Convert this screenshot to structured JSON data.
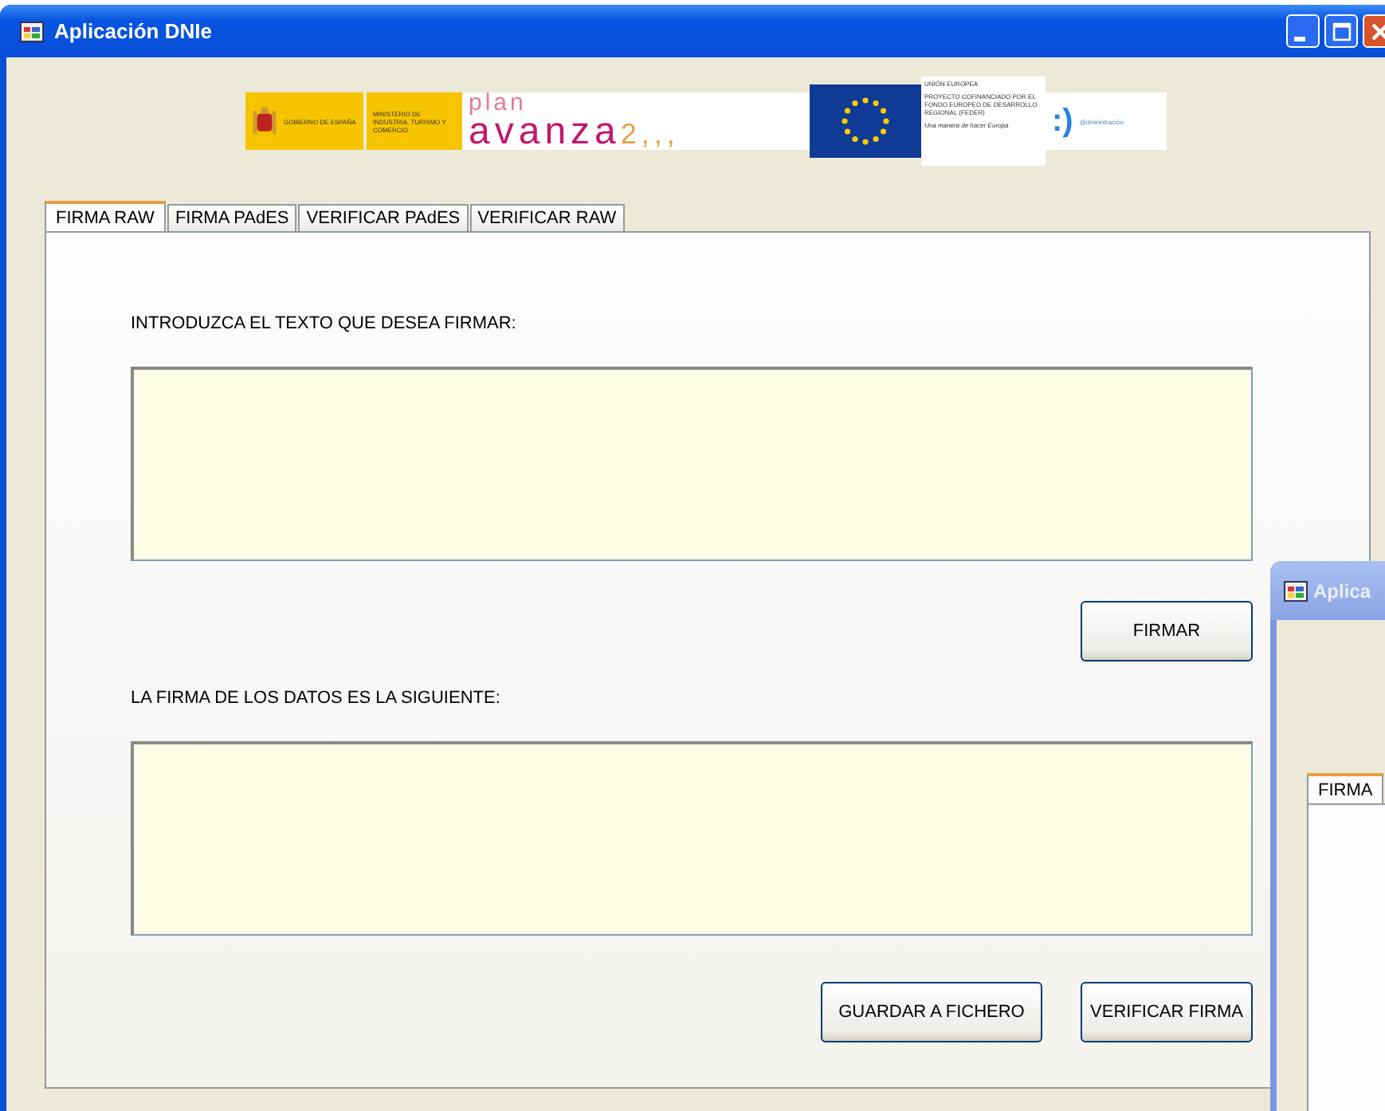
{
  "window": {
    "title": "Aplicación DNIe"
  },
  "banner": {
    "government": "GOBIERNO DE ESPAÑA",
    "ministry": "MINISTERIO DE INDUSTRIA, TURISMO Y COMERCIO",
    "plan": "plan",
    "avanza": "avanza",
    "avanza_number": "2,,,",
    "eu_heading": "UNIÓN EUROPEA",
    "eu_project": "PROYECTO COFINANCIADO POR EL FONDO EUROPEO DE DESARROLLO REGIONAL (FEDER)",
    "eu_motto": "Una manera de hacer Europa",
    "admin_smile": ":)",
    "admin_text": "@dministración"
  },
  "tabs": [
    {
      "label": "FIRMA RAW",
      "selected": true
    },
    {
      "label": "FIRMA PAdES",
      "selected": false
    },
    {
      "label": "VERIFICAR PAdES",
      "selected": false
    },
    {
      "label": "VERIFICAR RAW",
      "selected": false
    }
  ],
  "text_label": "INTRODUZCA EL TEXTO QUE DESEA FIRMAR:",
  "sign_button": "FIRMAR",
  "signature_label": "LA FIRMA DE LOS DATOS ES LA SIGUIENTE:",
  "buttons": [
    "GUARDAR A FICHERO",
    "VERIFICAR FIRMA"
  ],
  "second_window": {
    "title": "Aplica",
    "tabs": [
      {
        "label": "FIRMA",
        "selected": true
      }
    ]
  }
}
